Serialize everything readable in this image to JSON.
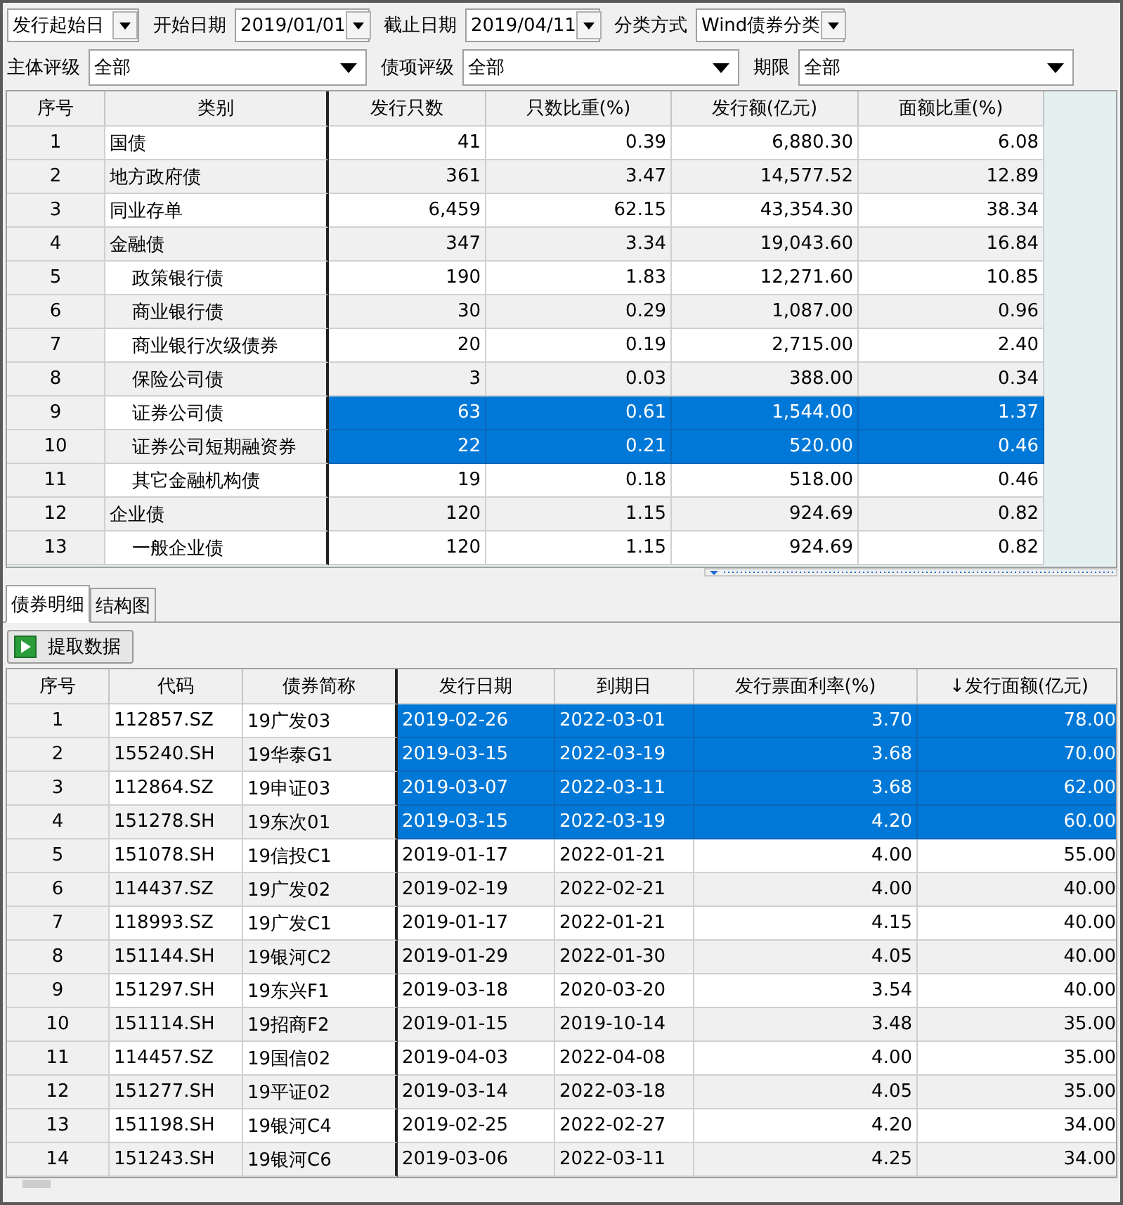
{
  "filters": [
    [
      {
        "value": "发行起始日"
      },
      {
        "label": "开始日期",
        "value": "2019/01/01"
      },
      {
        "label": "截止日期",
        "value": "2019/04/11"
      },
      {
        "label": "分类方式",
        "value": "Wind债券分类"
      }
    ],
    [
      {
        "label": "主体评级",
        "value": "全部"
      },
      {
        "label": "债项评级",
        "value": "全部"
      },
      {
        "label": "期限",
        "value": "全部"
      }
    ]
  ],
  "summary_table": {
    "columns": [
      "序号",
      "类别",
      "发行只数",
      "只数比重(%)",
      "发行额(亿元)",
      "面额比重(%)"
    ],
    "rows": [
      {
        "cells": [
          "1",
          "国债",
          "41",
          "0.39",
          "6,880.30",
          "6.08"
        ],
        "selected": false
      },
      {
        "cells": [
          "2",
          "地方政府债",
          "361",
          "3.47",
          "14,577.52",
          "12.89"
        ],
        "selected": false
      },
      {
        "cells": [
          "3",
          "同业存单",
          "6,459",
          "62.15",
          "43,354.30",
          "38.34"
        ],
        "selected": false
      },
      {
        "cells": [
          "4",
          "金融债",
          "347",
          "3.34",
          "19,043.60",
          "16.84"
        ],
        "selected": false,
        "children": [
          {
            "cells": [
              "5",
              "政策银行债",
              "190",
              "1.83",
              "12,271.60",
              "10.85"
            ],
            "selected": false
          },
          {
            "cells": [
              "6",
              "商业银行债",
              "30",
              "0.29",
              "1,087.00",
              "0.96"
            ],
            "selected": false
          },
          {
            "cells": [
              "7",
              "商业银行次级债券",
              "20",
              "0.19",
              "2,715.00",
              "2.40"
            ],
            "selected": false
          },
          {
            "cells": [
              "8",
              "保险公司债",
              "3",
              "0.03",
              "388.00",
              "0.34"
            ],
            "selected": false
          },
          {
            "cells": [
              "9",
              "证券公司债",
              "63",
              "0.61",
              "1,544.00",
              "1.37"
            ],
            "selected": true
          },
          {
            "cells": [
              "10",
              "证券公司短期融资券",
              "22",
              "0.21",
              "520.00",
              "0.46"
            ],
            "selected": true
          },
          {
            "cells": [
              "11",
              "其它金融机构债",
              "19",
              "0.18",
              "518.00",
              "0.46"
            ],
            "selected": false
          }
        ]
      },
      {
        "cells": [
          "12",
          "企业债",
          "120",
          "1.15",
          "924.69",
          "0.82"
        ],
        "selected": false,
        "children": [
          {
            "cells": [
              "13",
              "一般企业债",
              "120",
              "1.15",
              "924.69",
              "0.82"
            ],
            "selected": false
          }
        ]
      }
    ]
  },
  "tabs": [
    {
      "label": "债券明细",
      "selected": true
    },
    {
      "label": "结构图",
      "selected": false
    }
  ],
  "toolbar": {
    "button": "提取数据"
  },
  "detail_table": {
    "columns": [
      "序号",
      "代码",
      "债券简称",
      "发行日期",
      "到期日",
      "发行票面利率(%)",
      "↓发行面额(亿元)"
    ],
    "rows": [
      {
        "cells": [
          "1",
          "112857.SZ",
          "19广发03",
          "2019-02-26",
          "2022-03-01",
          "3.70",
          "78.00"
        ],
        "selected": true
      },
      {
        "cells": [
          "2",
          "155240.SH",
          "19华泰G1",
          "2019-03-15",
          "2022-03-19",
          "3.68",
          "70.00"
        ],
        "selected": true
      },
      {
        "cells": [
          "3",
          "112864.SZ",
          "19申证03",
          "2019-03-07",
          "2022-03-11",
          "3.68",
          "62.00"
        ],
        "selected": true
      },
      {
        "cells": [
          "4",
          "151278.SH",
          "19东次01",
          "2019-03-15",
          "2022-03-19",
          "4.20",
          "60.00"
        ],
        "selected": true
      },
      {
        "cells": [
          "5",
          "151078.SH",
          "19信投C1",
          "2019-01-17",
          "2022-01-21",
          "4.00",
          "55.00"
        ],
        "selected": false
      },
      {
        "cells": [
          "6",
          "114437.SZ",
          "19广发02",
          "2019-02-19",
          "2022-02-21",
          "4.00",
          "40.00"
        ],
        "selected": false
      },
      {
        "cells": [
          "7",
          "118993.SZ",
          "19广发C1",
          "2019-01-17",
          "2022-01-21",
          "4.15",
          "40.00"
        ],
        "selected": false
      },
      {
        "cells": [
          "8",
          "151144.SH",
          "19银河C2",
          "2019-01-29",
          "2022-01-30",
          "4.05",
          "40.00"
        ],
        "selected": false
      },
      {
        "cells": [
          "9",
          "151297.SH",
          "19东兴F1",
          "2019-03-18",
          "2020-03-20",
          "3.54",
          "40.00"
        ],
        "selected": false
      },
      {
        "cells": [
          "10",
          "151114.SH",
          "19招商F2",
          "2019-01-15",
          "2019-10-14",
          "3.48",
          "35.00"
        ],
        "selected": false
      },
      {
        "cells": [
          "11",
          "114457.SZ",
          "19国信02",
          "2019-04-03",
          "2022-04-08",
          "4.00",
          "35.00"
        ],
        "selected": false
      },
      {
        "cells": [
          "12",
          "151277.SH",
          "19平证02",
          "2019-03-14",
          "2022-03-18",
          "4.05",
          "35.00"
        ],
        "selected": false
      },
      {
        "cells": [
          "13",
          "151198.SH",
          "19银河C4",
          "2019-02-25",
          "2022-02-27",
          "4.20",
          "34.00"
        ],
        "selected": false
      },
      {
        "cells": [
          "14",
          "151243.SH",
          "19银河C6",
          "2019-03-06",
          "2022-03-11",
          "4.25",
          "34.00"
        ],
        "selected": false
      }
    ]
  }
}
